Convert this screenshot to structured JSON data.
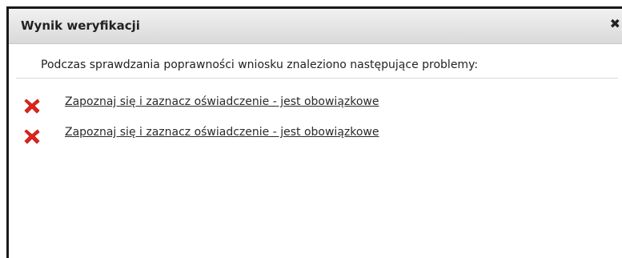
{
  "dialog": {
    "title": "Wynik weryfikacji",
    "close_icon": "close-icon",
    "message": "Podczas sprawdzania poprawności wniosku znaleziono następujące problemy:",
    "problems": [
      {
        "icon": "error-x-icon",
        "label": "Zapoznaj się i zaznacz oświadczenie - jest obowiązkowe"
      },
      {
        "icon": "error-x-icon",
        "label": "Zapoznaj się i zaznacz oświadczenie - jest obowiązkowe"
      }
    ]
  },
  "colors": {
    "error": "#e0241b",
    "text": "#222222"
  }
}
